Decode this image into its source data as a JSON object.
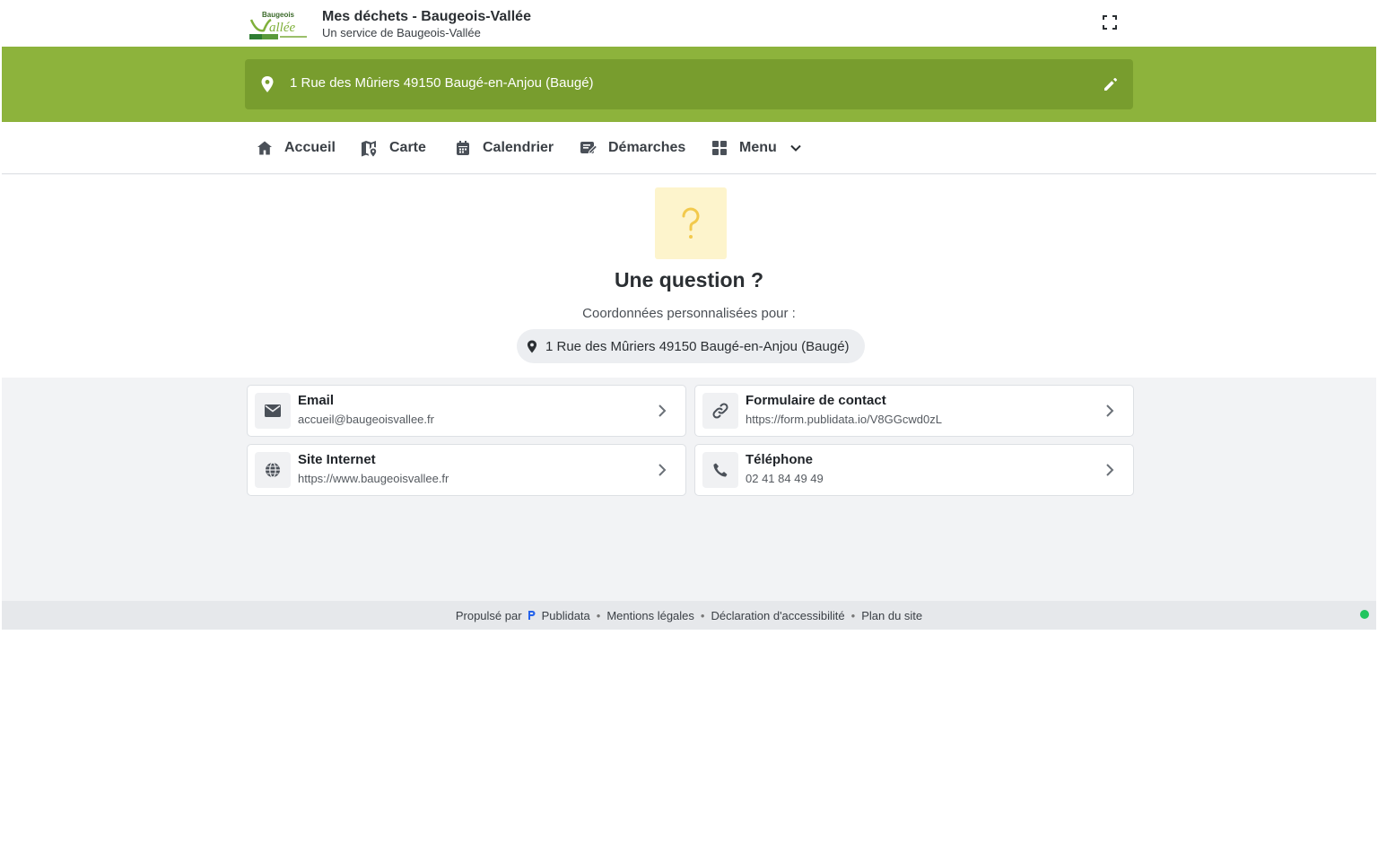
{
  "header": {
    "logo_label": "Baugeois Vallée",
    "title": "Mes déchets - Baugeois-Vallée",
    "subtitle": "Un service de Baugeois-Vallée",
    "fullscreen_icon": "fullscreen-icon"
  },
  "address": {
    "text": "1 Rue des Mûriers 49150 Baugé-en-Anjou (Baugé)",
    "pin_icon": "map-pin-icon",
    "edit_icon": "pencil-icon"
  },
  "nav": {
    "items": [
      {
        "label": "Accueil",
        "icon": "home-icon"
      },
      {
        "label": "Carte",
        "icon": "map-icon"
      },
      {
        "label": "Calendrier",
        "icon": "calendar-icon"
      },
      {
        "label": "Démarches",
        "icon": "form-edit-icon"
      },
      {
        "label": "Menu",
        "icon": "grid-icon"
      }
    ]
  },
  "question": {
    "icon": "question-mark-icon",
    "title": "Une question ?",
    "subtitle": "Coordonnées personnalisées pour :",
    "address": "1 Rue des Mûriers 49150 Baugé-en-Anjou (Baugé)"
  },
  "contacts": [
    {
      "title": "Email",
      "value": "accueil@baugeoisvallee.fr",
      "icon": "envelope-icon"
    },
    {
      "title": "Formulaire de contact",
      "value": "https://form.publidata.io/V8GGcwd0zL",
      "icon": "link-icon"
    },
    {
      "title": "Site Internet",
      "value": "https://www.baugeoisvallee.fr",
      "icon": "globe-icon"
    },
    {
      "title": "Téléphone",
      "value": "02 41 84 49 49",
      "icon": "phone-icon"
    }
  ],
  "footer": {
    "powered_by": "Propulsé par",
    "brand": "Publidata",
    "links": [
      "Mentions légales",
      "Déclaration d'accessibilité",
      "Plan du site"
    ],
    "separator": "•"
  },
  "colors": {
    "brand_green": "#8db33c",
    "address_bar": "#789d2e",
    "question_box": "#fdf4cc",
    "question_mark": "#f2c94c",
    "status": "#22c55e"
  }
}
